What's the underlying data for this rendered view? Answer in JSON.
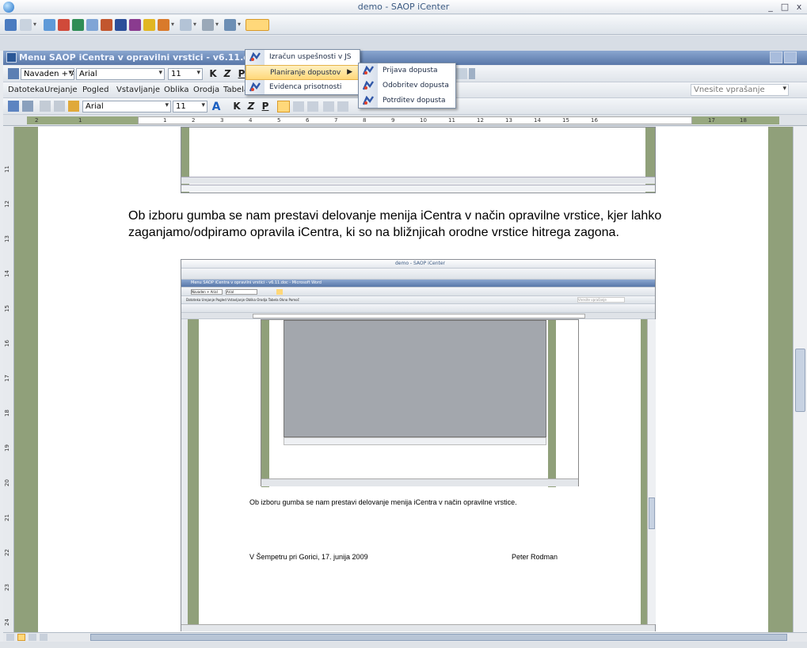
{
  "app": {
    "title": "demo - SAOP iCenter",
    "window_controls": [
      "_",
      "□",
      "x"
    ]
  },
  "word": {
    "title": "Menu SAOP iCentra v opravilni vrstici - v6.11.doc - Micro",
    "style_box": "Navaden + Arial",
    "font_box": "Arial",
    "size_box": "11",
    "menus": [
      "Datoteka",
      "Urejanje",
      "Pogled",
      "Vstavljanje",
      "Oblika",
      "Orodja",
      "Tabela"
    ],
    "help_box": "Vnesite vprašanje",
    "format_buttons": [
      "K",
      "Z",
      "P"
    ]
  },
  "dropdown": {
    "items": [
      "Izračun uspešnosti v JS",
      "Planiranje dopustov",
      "Evidenca prisotnosti"
    ],
    "highlighted": "Planiranje dopustov",
    "submenu": [
      "Prijava dopusta",
      "Odobritev dopusta",
      "Potrditev dopusta"
    ]
  },
  "ruler": {
    "ticks": [
      "2",
      "1",
      "1",
      "2",
      "3",
      "4",
      "5",
      "6",
      "7",
      "8",
      "9",
      "10",
      "11",
      "12",
      "13",
      "14",
      "15",
      "16",
      "17",
      "18"
    ],
    "vticks": [
      "11",
      "12",
      "13",
      "14",
      "15",
      "16",
      "17",
      "18",
      "19",
      "20",
      "21",
      "22",
      "23",
      "24"
    ]
  },
  "document": {
    "paragraph": "Ob izboru gumba se nam prestavi delovanje menija iCentra v način opravilne vrstice, kjer lahko zaganjamo/odpiramo opravila iCentra, ki so na bližnjicah orodne vrstice hitrega zagona.",
    "inner_paragraph": "Ob izboru gumba se nam prestavi delovanje menija iCentra v način opravilne vrstice.",
    "place_date": "V Šempetru pri Gorici, 17. junija 2009",
    "author": "Peter Rodman"
  },
  "inner_shot": {
    "title": "demo - SAOP iCenter",
    "word_title": "Menu SAOP iCentra v opravilni vrstici - v6.11.doc - Microsoft Word",
    "style_box": "Navaden + Arial",
    "font_box": "Arial",
    "menus": "Datoteka  Urejanje  Pogled  Vstavljanje  Oblika  Orodja  Tabela  Okno  Pomoč",
    "help_box": "Vnesite vprašanje"
  },
  "colors": {
    "accent": "#5877a8",
    "grey_panel": "#90a07a",
    "highlight": "#ffd87a"
  }
}
